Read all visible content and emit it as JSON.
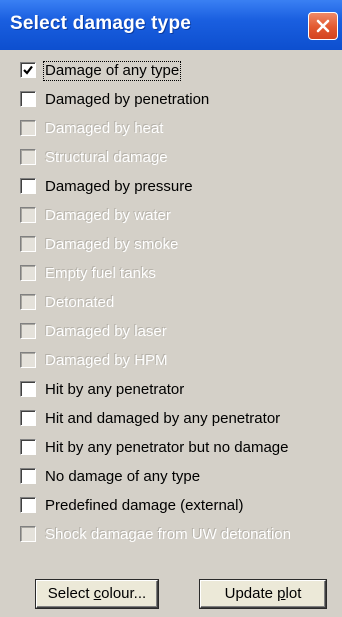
{
  "window": {
    "title": "Select damage type"
  },
  "options": [
    {
      "label": "Damage of any type",
      "checked": true,
      "enabled": true
    },
    {
      "label": "Damaged by penetration",
      "checked": false,
      "enabled": true
    },
    {
      "label": "Damaged by heat",
      "checked": false,
      "enabled": false
    },
    {
      "label": "Structural damage",
      "checked": false,
      "enabled": false
    },
    {
      "label": "Damaged by pressure",
      "checked": false,
      "enabled": true
    },
    {
      "label": "Damaged by water",
      "checked": false,
      "enabled": false
    },
    {
      "label": "Damaged by smoke",
      "checked": false,
      "enabled": false
    },
    {
      "label": "Empty fuel tanks",
      "checked": false,
      "enabled": false
    },
    {
      "label": "Detonated",
      "checked": false,
      "enabled": false
    },
    {
      "label": "Damaged by laser",
      "checked": false,
      "enabled": false
    },
    {
      "label": "Damaged by HPM",
      "checked": false,
      "enabled": false
    },
    {
      "label": "Hit by any penetrator",
      "checked": false,
      "enabled": true
    },
    {
      "label": "Hit and damaged by any penetrator",
      "checked": false,
      "enabled": true
    },
    {
      "label": "Hit by any penetrator but no damage",
      "checked": false,
      "enabled": true
    },
    {
      "label": "No damage of any type",
      "checked": false,
      "enabled": true
    },
    {
      "label": "Predefined damage (external)",
      "checked": false,
      "enabled": true
    },
    {
      "label": "Shock damagae from UW detonation",
      "checked": false,
      "enabled": false
    }
  ],
  "buttons": {
    "select_colour_pre": "Select ",
    "select_colour_key": "c",
    "select_colour_post": "olour...",
    "update_plot_pre": "Update ",
    "update_plot_key": "p",
    "update_plot_post": "lot"
  },
  "colors": {
    "title_bar": "#1a5fe0",
    "close_button": "#e2582f",
    "dialog_background": "#d4d0c8"
  },
  "icons": {
    "close": "close-icon",
    "check": "checkmark-icon"
  }
}
